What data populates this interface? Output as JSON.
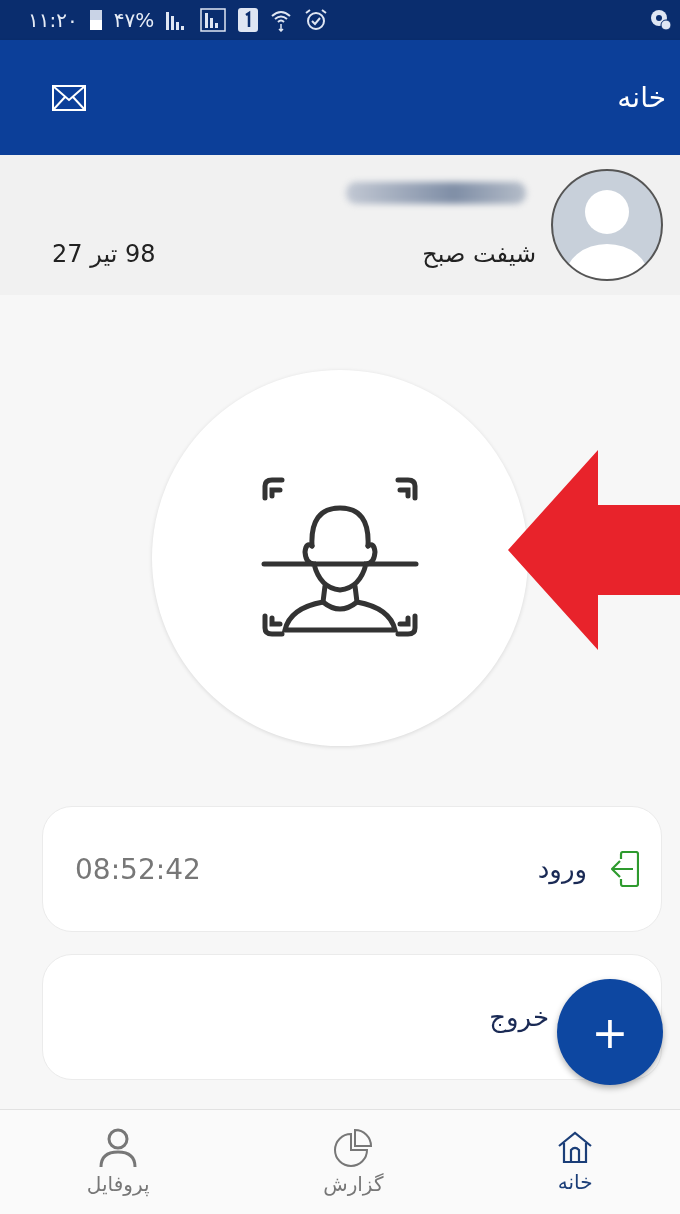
{
  "status_bar": {
    "time": "۱۱:۲۰",
    "battery": "۴۷%"
  },
  "header": {
    "title": "خانه"
  },
  "user": {
    "shift": "شیفت صبح",
    "date": "27 تیر 98"
  },
  "attendance": [
    {
      "kind": "entry",
      "label": "ورود",
      "time": "08:52:42"
    },
    {
      "kind": "exit",
      "label": "خروج"
    }
  ],
  "fab": {
    "label": "+"
  },
  "nav": [
    {
      "kind": "home",
      "label": "خانه",
      "selected": true
    },
    {
      "kind": "report",
      "label": "گزارش",
      "selected": false
    },
    {
      "kind": "profile",
      "label": "پروفایل",
      "selected": false
    }
  ]
}
